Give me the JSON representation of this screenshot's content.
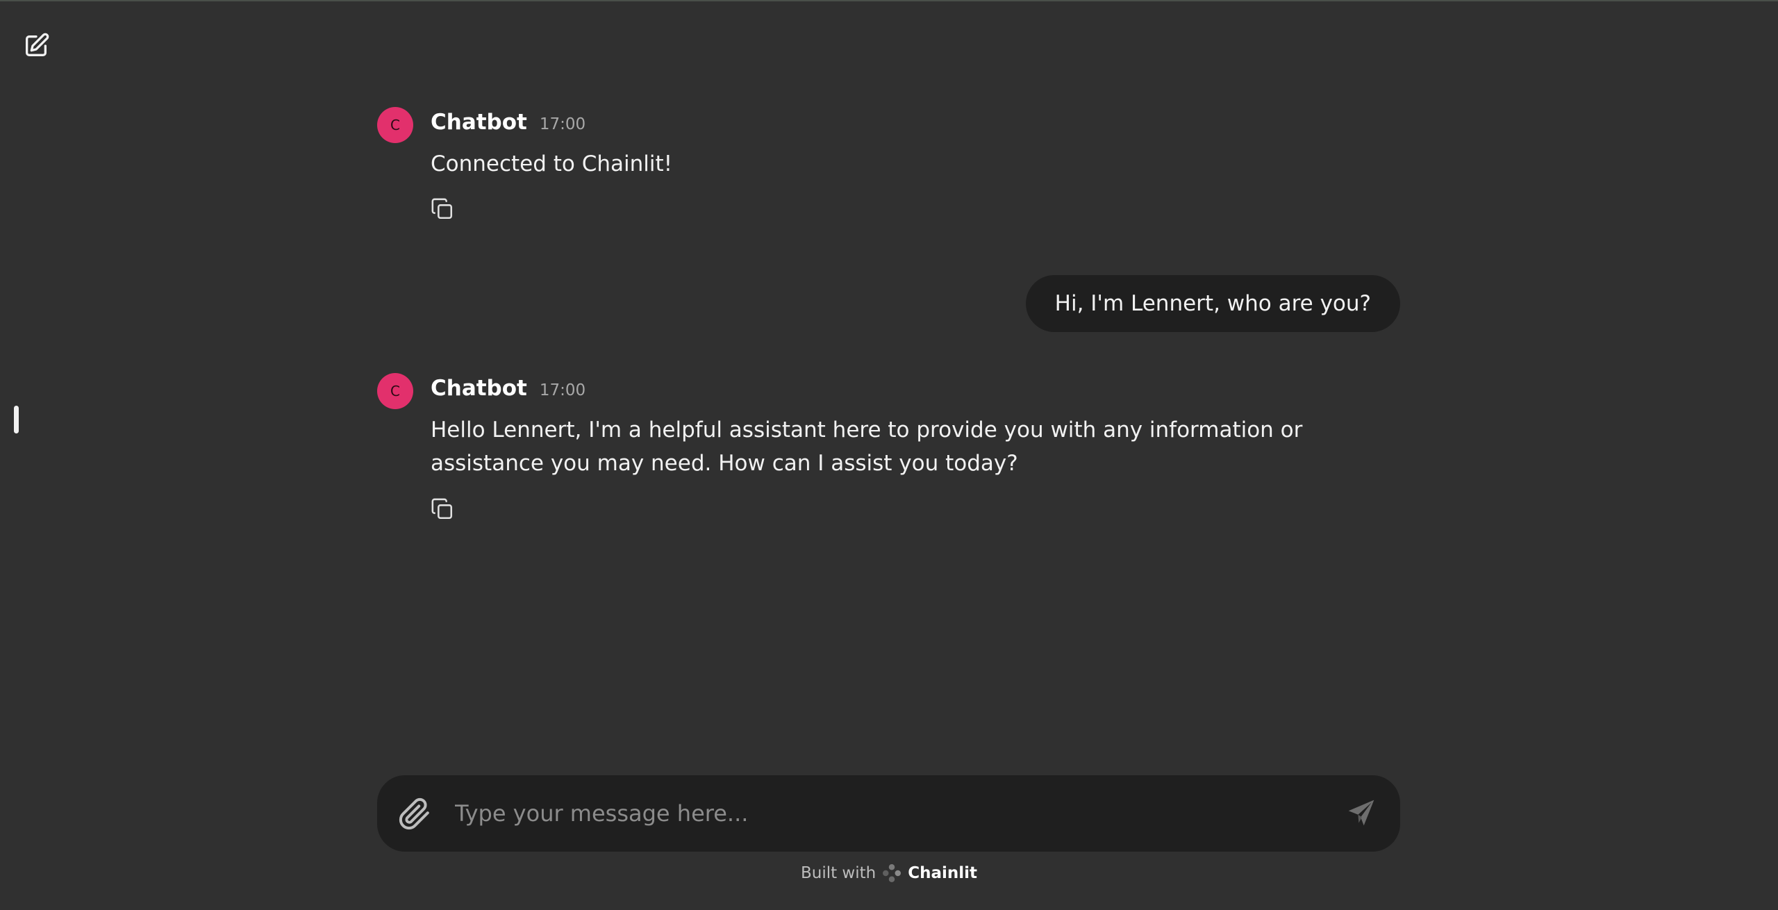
{
  "app": {
    "new_chat_icon": "edit-icon",
    "sidebar_handle_icon": "drag-handle"
  },
  "messages": [
    {
      "role": "assistant",
      "avatar_letter": "C",
      "author": "Chatbot",
      "time": "17:00",
      "text": "Connected to Chainlit!"
    },
    {
      "role": "user",
      "text": "Hi, I'm Lennert, who are you?"
    },
    {
      "role": "assistant",
      "avatar_letter": "C",
      "author": "Chatbot",
      "time": "17:00",
      "text": "Hello Lennert, I'm a helpful assistant here to provide you with any information or assistance you may need. How can I assist you today?"
    }
  ],
  "composer": {
    "placeholder": "Type your message here...",
    "value": ""
  },
  "footer": {
    "prefix": "Built with",
    "brand": "Chainlit"
  },
  "colors": {
    "background": "#303030",
    "surface": "#1f1f1f",
    "avatar": "#e2306c",
    "text": "#f2f2f2",
    "muted": "#a8a8a8"
  }
}
